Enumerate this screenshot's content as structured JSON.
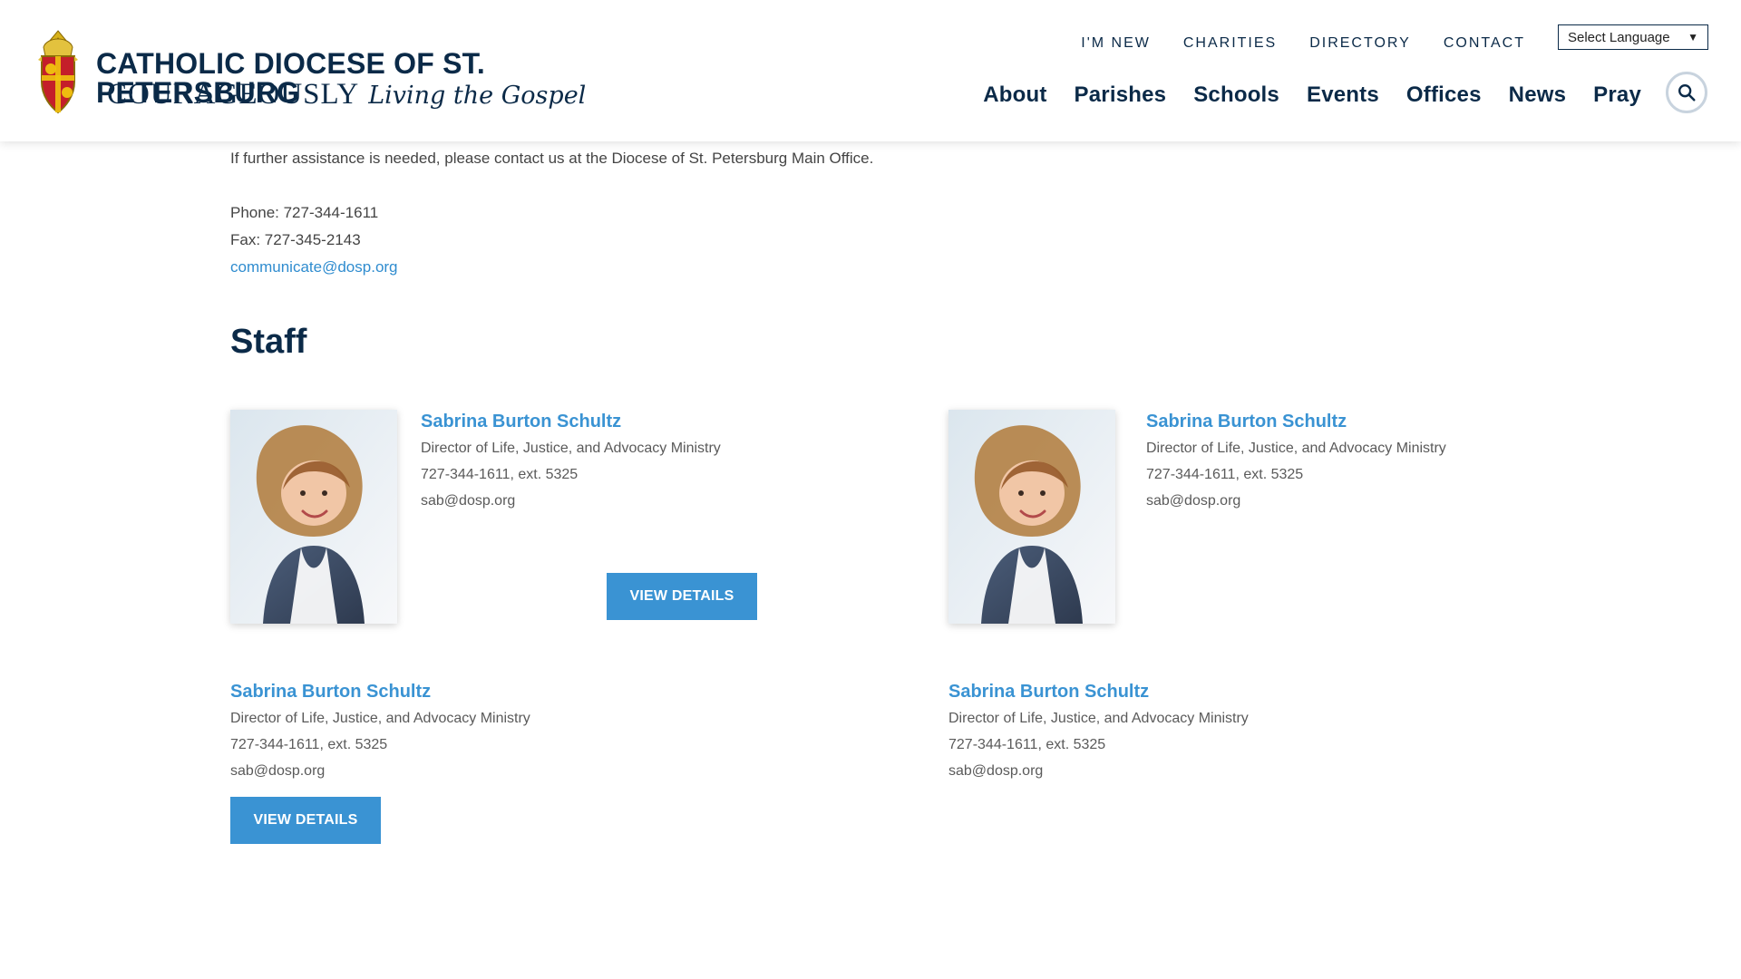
{
  "header": {
    "logo": {
      "title": "CATHOLIC DIOCESE OF ST. PETERSBURG",
      "subtitle_caps": "COURAGEOUSLY",
      "subtitle_script": "Living the Gospel"
    },
    "top_links": [
      "I'M NEW",
      "CHARITIES",
      "DIRECTORY",
      "CONTACT"
    ],
    "language_select": {
      "selected": "Select Language"
    },
    "main_links": [
      "About",
      "Parishes",
      "Schools",
      "Events",
      "Offices",
      "News",
      "Pray"
    ]
  },
  "content": {
    "assist_text": "If further assistance is needed, please contact us at the Diocese of St. Petersburg Main Office.",
    "phone": "Phone: 727-344-1611",
    "fax": "Fax: 727-345-2143",
    "email": "communicate@dosp.org",
    "staff_heading": "Staff",
    "staff": [
      {
        "name": "Sabrina Burton Schultz",
        "title": "Director of Life, Justice, and Advocacy Ministry",
        "phone": "727-344-1611,  ext. 5325",
        "email": "sab@dosp.org",
        "button_label": "VIEW DETAILS"
      },
      {
        "name": "Sabrina Burton Schultz",
        "title": "Director of Life, Justice, and Advocacy Ministry",
        "phone": "727-344-1611,  ext. 5325",
        "email": "sab@dosp.org"
      },
      {
        "name": "Sabrina Burton Schultz",
        "title": "Director of Life, Justice, and Advocacy Ministry",
        "phone": "727-344-1611,  ext. 5325",
        "email": "sab@dosp.org",
        "button_label": "VIEW DETAILS"
      },
      {
        "name": "Sabrina Burton Schultz",
        "title": "Director of Life, Justice, and Advocacy Ministry",
        "phone": "727-344-1611,  ext. 5325",
        "email": "sab@dosp.org"
      }
    ]
  },
  "icons": {
    "search": "search-icon",
    "dropdown": "chevron-down-icon",
    "crest": "crest-icon"
  },
  "colors": {
    "navy": "#0b2a48",
    "accent_blue": "#3a93d3"
  }
}
